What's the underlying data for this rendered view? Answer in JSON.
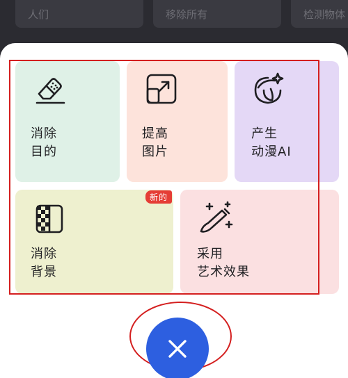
{
  "top_bar": {
    "pills": [
      "人们",
      "移除所有",
      "检测物体"
    ]
  },
  "tools": {
    "erase_object": "消除\n目的",
    "enhance_photo": "提高\n图片",
    "anime_ai": "产生\n动漫AI",
    "remove_background": "消除\n背景",
    "art_effect": "采用\n艺术效果"
  },
  "badges": {
    "new": "新的"
  },
  "icons": {
    "erase_object": "eraser-icon",
    "enhance_photo": "enlarge-icon",
    "anime_ai": "anime-face-icon",
    "remove_background": "transparent-bg-icon",
    "art_effect": "magic-brush-icon",
    "close": "close-icon"
  },
  "colors": {
    "close_button": "#2d5fe0",
    "badge": "#e53d36",
    "annotation": "#d41f1f"
  }
}
